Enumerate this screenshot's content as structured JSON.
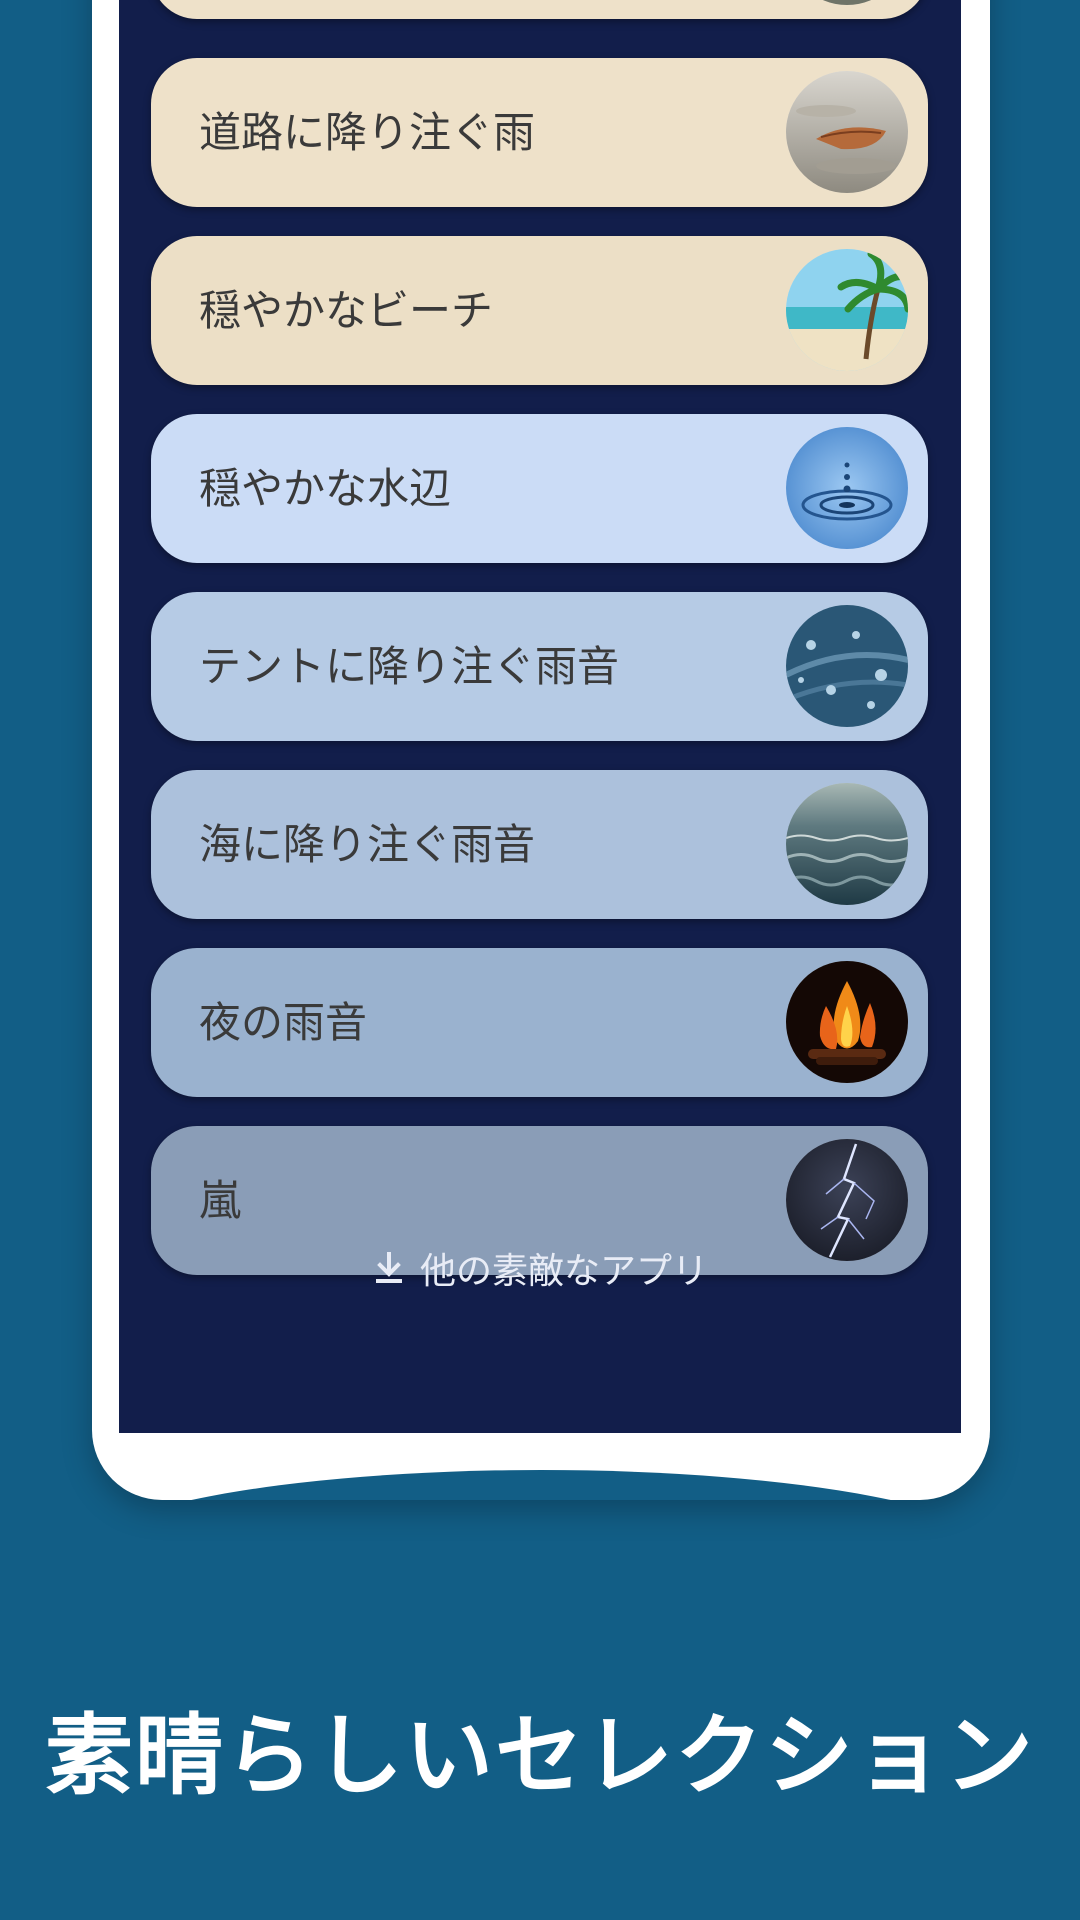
{
  "sound_list": {
    "items": [
      {
        "label": "",
        "color": "#eee1c9",
        "thumb": "rocks-thumbnail"
      },
      {
        "label": "道路に降り注ぐ雨",
        "color": "#eee1c9",
        "thumb": "puddle-leaf-thumbnail"
      },
      {
        "label": "穏やかなビーチ",
        "color": "#ecdfc6",
        "thumb": "tropical-beach-thumbnail"
      },
      {
        "label": "穏やかな水辺",
        "color": "#cbdcf6",
        "thumb": "water-drop-thumbnail"
      },
      {
        "label": "テントに降り注ぐ雨音",
        "color": "#b6cbe5",
        "thumb": "tent-raindrops-thumbnail"
      },
      {
        "label": "海に降り注ぐ雨音",
        "color": "#acc1dc",
        "thumb": "ocean-waves-thumbnail"
      },
      {
        "label": "夜の雨音",
        "color": "#9ab2cf",
        "thumb": "campfire-thumbnail"
      },
      {
        "label": "嵐",
        "color": "#8a9db7",
        "thumb": "lightning-thumbnail"
      }
    ]
  },
  "more_apps": {
    "icon": "download-icon",
    "label": "他の素敵なアプリ"
  },
  "headline": {
    "text": "素晴らしいセレクション"
  },
  "colors": {
    "page_background": "#125e86",
    "screen_background": "#121e4b",
    "frame": "#ffffff"
  }
}
